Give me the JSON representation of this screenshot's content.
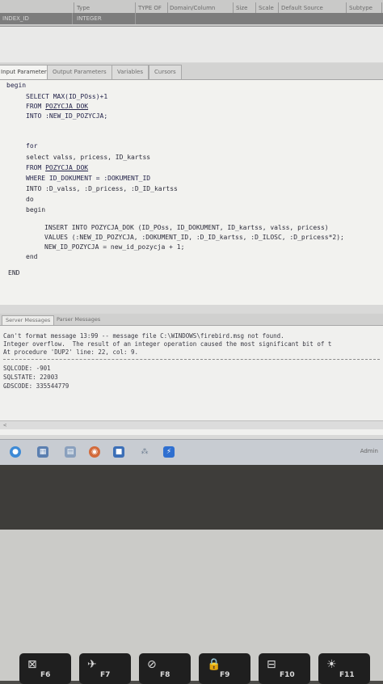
{
  "grid_header": {
    "row1": [
      "Type",
      "TYPE OF",
      "Domain/Column",
      "Size",
      "Scale",
      "Default Source",
      "Subtype"
    ],
    "row2": [
      "INDEX_ID",
      "INTEGER"
    ]
  },
  "tabs": [
    "Input Parameters",
    "Output Parameters",
    "Variables",
    "Cursors"
  ],
  "code": {
    "l1": "begin",
    "l2": "SELECT MAX(ID_POss)+1",
    "l3a": "FROM ",
    "l3b": "POZYCJA_DOK",
    "l4": "INTO :NEW_ID_POZYCJA;",
    "l5": "for",
    "l6": "select valss, pricess, ID_kartss",
    "l7a": "FROM ",
    "l7b": "POZYCJA_DOK",
    "l8": "WHERE ID_DOKUMENT = :DOKUMENT_ID",
    "l9": "INTO :D_valss, :D_pricess, :D_ID_kartss",
    "l10": "do",
    "l11": "begin",
    "l12": "INSERT INTO POZYCJA_DOK (ID_POss, ID_DOKUMENT, ID_kartss, valss, pricess)",
    "l13": "VALUES (:NEW_ID_POZYCJA, :DOKUMENT_ID, :D_ID_kartss, :D_ILOSC, :D_pricess*2);",
    "l14": "NEW_ID_POZYCJA = new_id_pozycja + 1;",
    "l15": "end",
    "l16": "END"
  },
  "message_tabs": [
    "Server Messages",
    "Parser Messages"
  ],
  "messages": [
    "Can't format message 13:99 -- message file C:\\WINDOWS\\firebird.msg not found.",
    "Integer overflow.  The result of an integer operation caused the most significant bit of t",
    "At procedure 'DUP2' line: 22, col: 9.",
    "SQLCODE: -901",
    "SQLSTATE: 22003",
    "GDSCODE: 335544779"
  ],
  "taskbar": {
    "admin_label": "Admin",
    "icons": [
      "chrome-icon",
      "app-grid-icon",
      "folder-icon",
      "firefox-icon",
      "media-icon",
      "network-icon",
      "ibexpert-icon"
    ]
  },
  "keys": [
    {
      "glyph": "⊠",
      "label": "F6"
    },
    {
      "glyph": "✈",
      "label": "F7"
    },
    {
      "glyph": "⊘",
      "label": "F8"
    },
    {
      "glyph": "🔒",
      "label": "F9"
    },
    {
      "glyph": "⊟",
      "label": "F10"
    },
    {
      "glyph": "☀",
      "label": "F11"
    }
  ],
  "colors": {
    "editor_bg": "#f2f2ef",
    "keyword": "#24244a"
  }
}
